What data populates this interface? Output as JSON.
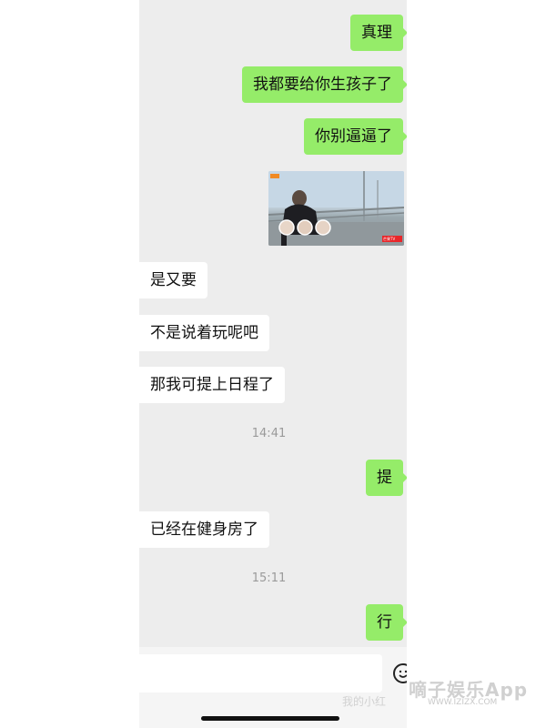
{
  "messages": [
    {
      "side": "out",
      "text": "真理"
    },
    {
      "side": "out",
      "text": "我都要给你生孩子了"
    },
    {
      "side": "out",
      "text": "你别逼逼了"
    },
    {
      "side": "in",
      "text": "是又要"
    },
    {
      "side": "in",
      "text": "不是说着玩呢吧"
    },
    {
      "side": "in",
      "text": "那我可提上日程了"
    },
    {
      "side": "out",
      "text": "提"
    },
    {
      "side": "in",
      "text": "已经在健身房了"
    },
    {
      "side": "out",
      "text": "行"
    }
  ],
  "timestamps": [
    "14:41",
    "15:11"
  ],
  "video": {
    "badge": "芒果TV"
  },
  "colors": {
    "outgoing_bubble": "#95ec69",
    "incoming_bubble": "#ffffff",
    "chat_background": "#ededed"
  },
  "icons": {
    "emoji": "smiley-icon"
  },
  "watermark": {
    "main": "嘀子娱乐App",
    "sub": "WWW.IZIZX.COM",
    "left": "我的小红"
  }
}
